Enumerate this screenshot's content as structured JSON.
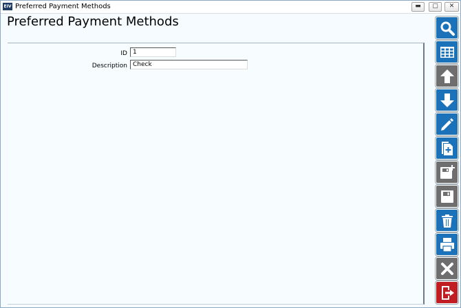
{
  "window": {
    "title": "Preferred Payment Methods",
    "app_icon_text": "EIV",
    "minimize_glyph": "▬",
    "maximize_glyph": "▢",
    "close_glyph": "✕"
  },
  "page": {
    "title": "Preferred Payment Methods"
  },
  "form": {
    "id_label": "ID",
    "id_value": "1",
    "description_label": "Description",
    "description_value": "Check"
  },
  "toolbar": {
    "buttons": [
      {
        "icon": "search-icon",
        "color": "#1c72b8"
      },
      {
        "icon": "grid-icon",
        "color": "#1c72b8"
      },
      {
        "icon": "arrow-up-icon",
        "color": "#6e6e6e"
      },
      {
        "icon": "arrow-down-icon",
        "color": "#1c72b8"
      },
      {
        "icon": "pencil-icon",
        "color": "#1c72b8"
      },
      {
        "icon": "new-document-icon",
        "color": "#1c72b8"
      },
      {
        "icon": "save-new-icon",
        "color": "#6e6e6e"
      },
      {
        "icon": "save-icon",
        "color": "#6e6e6e"
      },
      {
        "icon": "trash-icon",
        "color": "#1c72b8"
      },
      {
        "icon": "print-icon",
        "color": "#1c72b8"
      },
      {
        "icon": "cancel-x-icon",
        "color": "#6e6e6e"
      },
      {
        "icon": "exit-door-icon",
        "color": "#c01e22"
      }
    ]
  }
}
